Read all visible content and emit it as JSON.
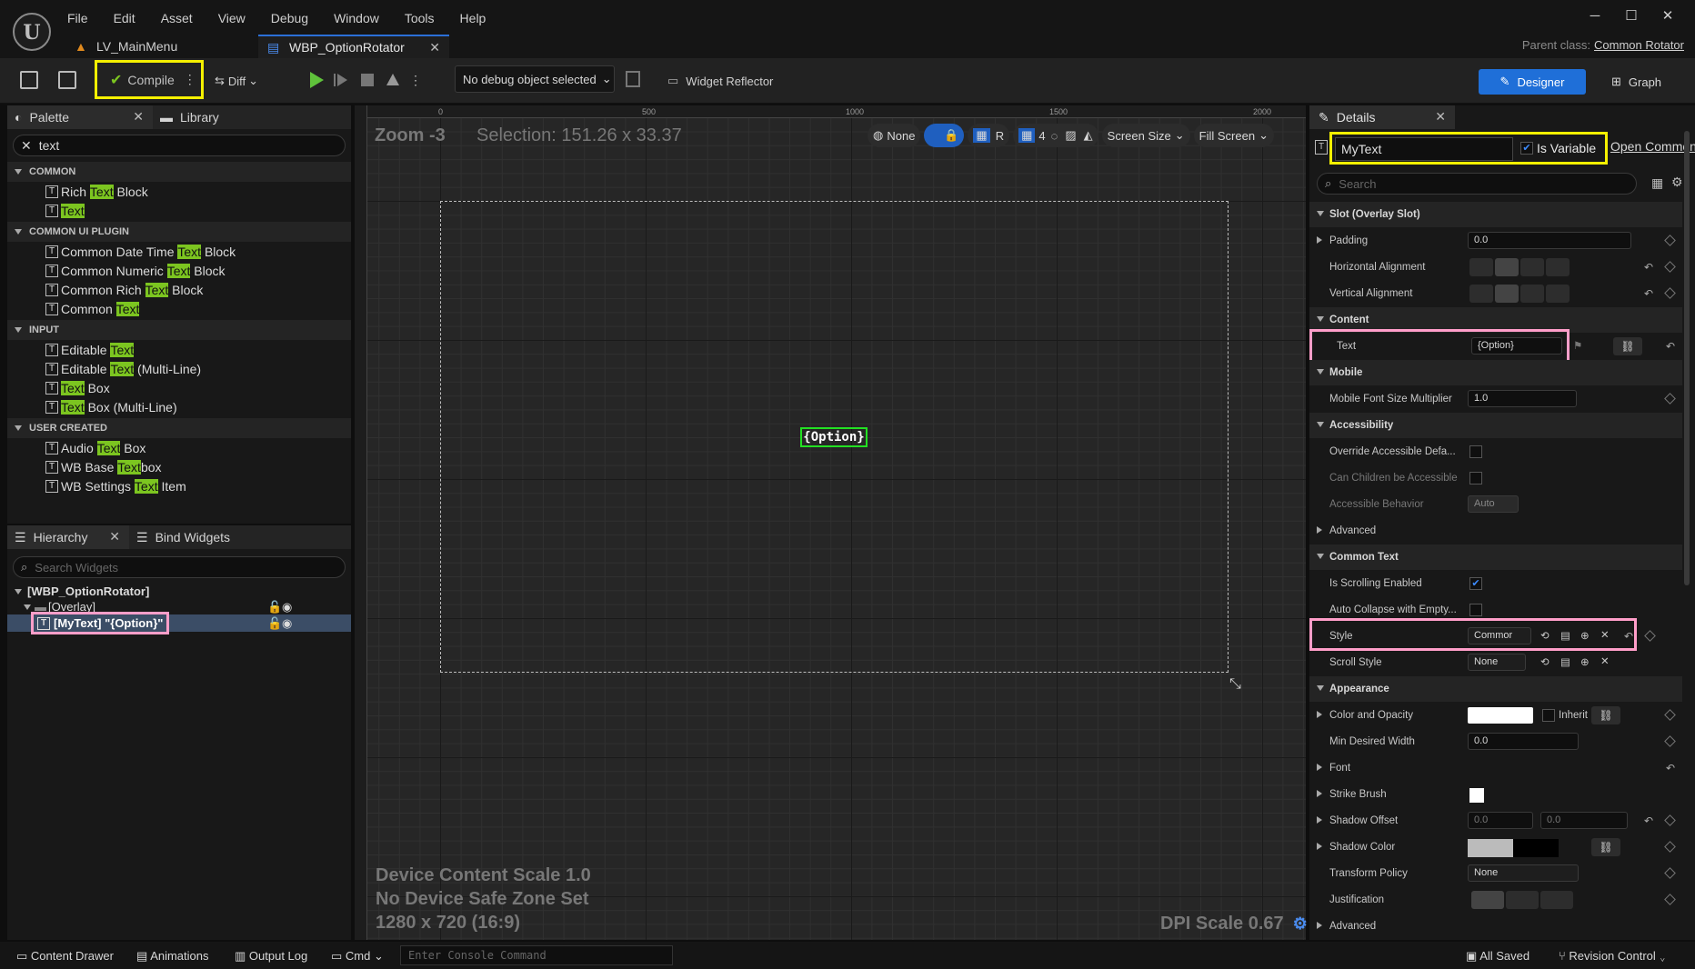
{
  "menu": [
    "File",
    "Edit",
    "Asset",
    "View",
    "Debug",
    "Window",
    "Tools",
    "Help"
  ],
  "tabs": [
    {
      "label": "LV_MainMenu"
    },
    {
      "label": "WBP_OptionRotator"
    }
  ],
  "parent_class": {
    "label": "Parent class:",
    "value": "Common Rotator"
  },
  "toolbar": {
    "compile": "Compile",
    "diff": "Diff",
    "debug_object": "No debug object selected",
    "widget_reflector": "Widget Reflector",
    "designer": "Designer",
    "graph": "Graph"
  },
  "palette": {
    "tab": "Palette",
    "library_tab": "Library",
    "search_value": "text",
    "categories": [
      {
        "name": "COMMON",
        "items": [
          {
            "pre": "Rich ",
            "hl": "Text",
            "post": " Block"
          },
          {
            "pre": "",
            "hl": "Text",
            "post": ""
          }
        ]
      },
      {
        "name": "COMMON UI PLUGIN",
        "items": [
          {
            "pre": "Common Date Time ",
            "hl": "Text",
            "post": " Block"
          },
          {
            "pre": "Common Numeric ",
            "hl": "Text",
            "post": " Block"
          },
          {
            "pre": "Common Rich ",
            "hl": "Text",
            "post": " Block"
          },
          {
            "pre": "Common ",
            "hl": "Text",
            "post": ""
          }
        ]
      },
      {
        "name": "INPUT",
        "items": [
          {
            "pre": "Editable ",
            "hl": "Text",
            "post": ""
          },
          {
            "pre": "Editable ",
            "hl": "Text",
            "post": " (Multi-Line)"
          },
          {
            "pre": "",
            "hl": "Text",
            "post": " Box"
          },
          {
            "pre": "",
            "hl": "Text",
            "post": " Box (Multi-Line)"
          }
        ]
      },
      {
        "name": "USER CREATED",
        "items": [
          {
            "pre": "Audio ",
            "hl": "Text",
            "post": " Box"
          },
          {
            "pre": "WB Base ",
            "hl": "Text",
            "post": "box"
          },
          {
            "pre": "WB Settings ",
            "hl": "Text",
            "post": " Item"
          }
        ]
      }
    ]
  },
  "hierarchy": {
    "tab": "Hierarchy",
    "bind_tab": "Bind Widgets",
    "search_placeholder": "Search Widgets",
    "root": "[WBP_OptionRotator]",
    "overlay": "[Overlay]",
    "selected": "[MyText] \"{Option}\""
  },
  "canvas": {
    "zoom": "Zoom -3",
    "selection": "Selection: 151.26 x 33.37",
    "ruler_top": [
      "0",
      "500",
      "1000",
      "1500",
      "2000"
    ],
    "widget_text": "{Option}",
    "none_label": "None",
    "r_label": "R",
    "grid_num": "4",
    "screen_size": "Screen Size",
    "fill_screen": "Fill Screen",
    "device_scale": "Device Content Scale 1.0",
    "safe_zone": "No Device Safe Zone Set",
    "resolution": "1280 x 720 (16:9)",
    "dpi": "DPI Scale 0.67"
  },
  "details": {
    "tab": "Details",
    "name_value": "MyText",
    "is_variable": "Is Variable",
    "open_common": "Open CommonT",
    "search_placeholder": "Search",
    "rows": {
      "slot": "Slot (Overlay Slot)",
      "padding": "Padding",
      "padding_val": "0.0",
      "halign": "Horizontal Alignment",
      "valign": "Vertical Alignment",
      "content": "Content",
      "text": "Text",
      "text_val": "{Option}",
      "mobile": "Mobile",
      "mobile_font": "Mobile Font Size Multiplier",
      "mobile_font_val": "1.0",
      "accessibility": "Accessibility",
      "override_acc": "Override Accessible Defa...",
      "can_children": "Can Children be Accessible",
      "acc_behavior": "Accessible Behavior",
      "acc_behavior_val": "Auto",
      "advanced": "Advanced",
      "common_text": "Common Text",
      "is_scrolling": "Is Scrolling Enabled",
      "auto_collapse": "Auto Collapse with Empty...",
      "style": "Style",
      "style_val": "Commor",
      "scroll_style": "Scroll Style",
      "scroll_style_val": "None",
      "appearance": "Appearance",
      "color_opacity": "Color and Opacity",
      "inherit": "Inherit",
      "min_width": "Min Desired Width",
      "min_width_val": "0.0",
      "font": "Font",
      "strike": "Strike Brush",
      "shadow_offset": "Shadow Offset",
      "shadow_x": "0.0",
      "shadow_y": "0.0",
      "shadow_color": "Shadow Color",
      "transform": "Transform Policy",
      "transform_val": "None",
      "justification": "Justification",
      "advanced2": "Advanced"
    }
  },
  "bottom": {
    "content_drawer": "Content Drawer",
    "animations": "Animations",
    "output_log": "Output Log",
    "cmd": "Cmd",
    "console_placeholder": "Enter Console Command",
    "all_saved": "All Saved",
    "revision": "Revision Control"
  },
  "colors": {
    "accent": "#1f6fd8",
    "highlight": "#7cc520",
    "annotation_yellow": "#f5f000",
    "annotation_pink": "#ff9ec9"
  }
}
